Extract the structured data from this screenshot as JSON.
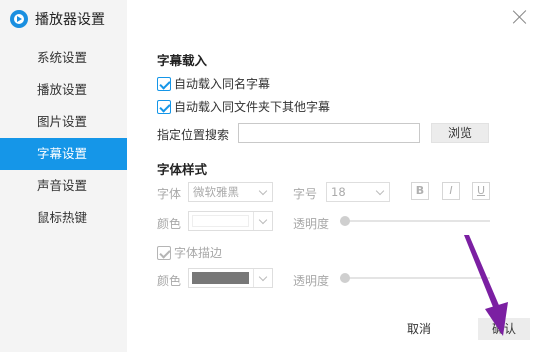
{
  "app": {
    "title": "播放器设置",
    "logo_icon": "player-logo-icon",
    "close_icon": "close-icon"
  },
  "sidebar": {
    "items": [
      {
        "label": "系统设置",
        "active": false
      },
      {
        "label": "播放设置",
        "active": false
      },
      {
        "label": "图片设置",
        "active": false
      },
      {
        "label": "字幕设置",
        "active": true
      },
      {
        "label": "声音设置",
        "active": false
      },
      {
        "label": "鼠标热键",
        "active": false
      }
    ],
    "active_color": "#1596e8"
  },
  "subtitle_load": {
    "title": "字幕载入",
    "auto_load_same_name": {
      "label": "自动载入同名字幕",
      "checked": true
    },
    "auto_load_folder": {
      "label": "自动载入同文件夹下其他字幕",
      "checked": true
    },
    "path_search": {
      "label": "指定位置搜索",
      "value": "",
      "browse_label": "浏览"
    }
  },
  "font_style": {
    "title": "字体样式",
    "font": {
      "label": "字体",
      "value": "微软雅黑"
    },
    "size": {
      "label": "字号",
      "value": "18"
    },
    "bold_label": "B",
    "italic_label": "I",
    "underline_label": "U",
    "color": {
      "label": "颜色",
      "value": "#ffffff"
    },
    "opacity": {
      "label": "透明度",
      "value": 0
    },
    "stroke": {
      "label": "字体描边",
      "checked": true
    },
    "stroke_color": {
      "label": "颜色",
      "value": "#777777"
    },
    "stroke_opacity": {
      "label": "透明度",
      "value": 0
    }
  },
  "footer": {
    "cancel_label": "取消",
    "confirm_label": "确认"
  },
  "annotation": {
    "color": "#7b1fa2"
  }
}
